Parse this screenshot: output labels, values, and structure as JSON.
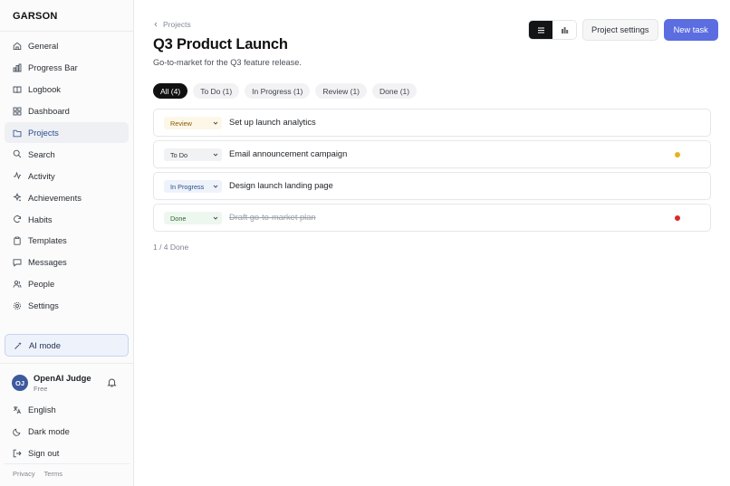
{
  "app": {
    "brand": "GARSON"
  },
  "sidebar": {
    "items": [
      {
        "label": "General",
        "icon": "home-icon"
      },
      {
        "label": "Progress Bar",
        "icon": "bar-chart-icon"
      },
      {
        "label": "Logbook",
        "icon": "book-icon"
      },
      {
        "label": "Dashboard",
        "icon": "grid-icon"
      },
      {
        "label": "Projects",
        "icon": "folder-icon",
        "active": true
      },
      {
        "label": "Search",
        "icon": "search-icon"
      },
      {
        "label": "Activity",
        "icon": "activity-icon"
      },
      {
        "label": "Achievements",
        "icon": "sparkle-icon"
      },
      {
        "label": "Habits",
        "icon": "repeat-icon"
      },
      {
        "label": "Templates",
        "icon": "clipboard-icon"
      },
      {
        "label": "Messages",
        "icon": "message-icon"
      },
      {
        "label": "People",
        "icon": "people-icon"
      },
      {
        "label": "Settings",
        "icon": "gear-icon"
      }
    ],
    "ai_mode": "AI mode",
    "user": {
      "initials": "OJ",
      "name": "OpenAI Judge",
      "plan": "Free"
    },
    "bottom": [
      {
        "label": "English",
        "icon": "language-icon"
      },
      {
        "label": "Dark mode",
        "icon": "moon-icon"
      },
      {
        "label": "Sign out",
        "icon": "sign-out-icon"
      }
    ],
    "footer": {
      "privacy": "Privacy",
      "terms": "Terms"
    }
  },
  "main": {
    "breadcrumb": "Projects",
    "title": "Q3 Product Launch",
    "subtitle": "Go-to-market for the Q3 feature release.",
    "toolbar": {
      "settings": "Project settings",
      "new_task": "New task"
    },
    "filters": [
      {
        "label": "All (4)",
        "active": true
      },
      {
        "label": "To Do (1)"
      },
      {
        "label": "In Progress (1)"
      },
      {
        "label": "Review (1)"
      },
      {
        "label": "Done (1)"
      }
    ],
    "tasks": [
      {
        "status": "Review",
        "title": "Set up launch analytics",
        "priority_color": null
      },
      {
        "status": "To Do",
        "title": "Email announcement campaign",
        "priority_color": "#e6b31e"
      },
      {
        "status": "In Progress",
        "title": "Design launch landing page",
        "priority_color": null
      },
      {
        "status": "Done",
        "title": "Draft go-to-market plan",
        "priority_color": "#d92b2b"
      }
    ],
    "progress": "1 / 4 Done"
  }
}
